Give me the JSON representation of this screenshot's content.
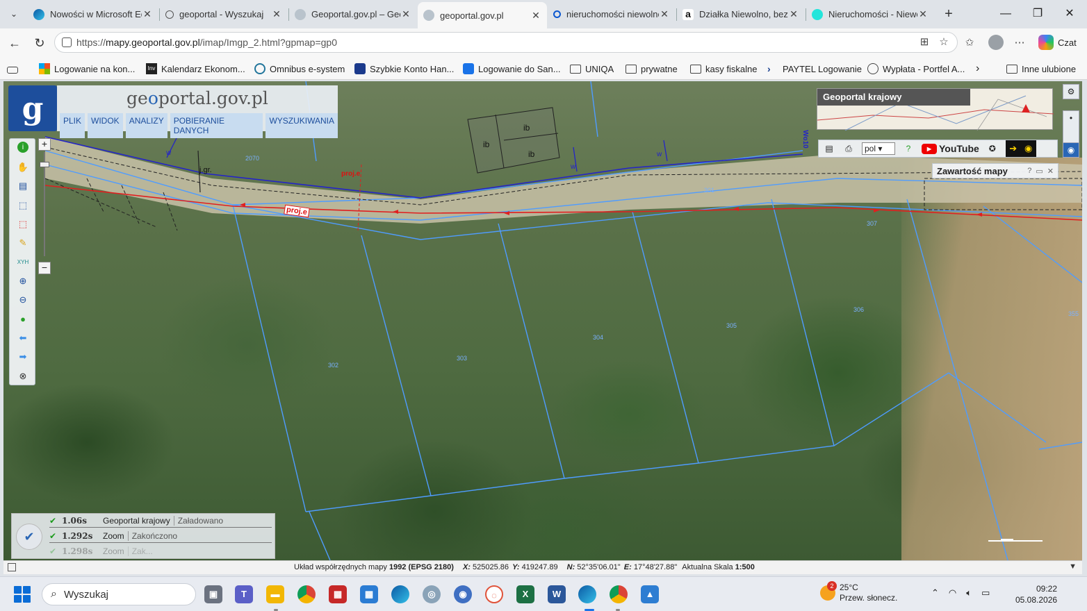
{
  "tabs": [
    {
      "title": "Nowości w Microsoft Edge",
      "icon": "edge-icon"
    },
    {
      "title": "geoportal - Wyszukaj",
      "icon": "search-icon"
    },
    {
      "title": "Geoportal.gov.pl – Geoportal",
      "icon": "geoportal-icon"
    },
    {
      "title": "geoportal.gov.pl",
      "icon": "geoportal-icon",
      "active": true
    },
    {
      "title": "nieruchomości niewolno",
      "icon": "search-icon"
    },
    {
      "title": "Działka Niewolno, bez p",
      "icon": "amazon-icon"
    },
    {
      "title": "Nieruchomości - Niewolno",
      "icon": "olx-icon"
    }
  ],
  "address": {
    "prefix": "https://",
    "host": "mapy.geoportal.gov.pl",
    "path": "/imap/Imgp_2.html?gpmap=gp0"
  },
  "copilot_label": "Czat",
  "favorites": [
    {
      "label": "Logowanie na kon...",
      "icon": "microsoft-icon"
    },
    {
      "label": "Kalendarz Ekonom...",
      "icon": "inv-icon"
    },
    {
      "label": "Omnibus e-system",
      "icon": "wordpress-icon"
    },
    {
      "label": "Szybkie Konto Han...",
      "icon": "pko-icon"
    },
    {
      "label": "Logowanie do San...",
      "icon": "doc-icon"
    },
    {
      "label": "UNIQA",
      "icon": "folder-icon"
    },
    {
      "label": "prywatne",
      "icon": "folder-icon"
    },
    {
      "label": "kasy fiskalne",
      "icon": "folder-icon"
    },
    {
      "label": "PAYTEL Logowanie",
      "icon": "arrow-icon"
    },
    {
      "label": "Wypłata - Portfel A...",
      "icon": "globe-icon"
    }
  ],
  "favorites_other": "Inne ulubione",
  "geoportal": {
    "site_name_prefix": "ge",
    "site_name_o": "o",
    "site_name_rest": "portal.gov.pl",
    "menu": [
      "PLIK",
      "WIDOK",
      "ANALIZY",
      "POBIERANIE DANYCH",
      "WYSZUKIWANIA"
    ],
    "overview_title": "Geoportal krajowy",
    "language": "pol",
    "youtube_label": "YouTube",
    "content_panel_title": "Zawartość mapy"
  },
  "map_labels": {
    "ib": [
      "ib",
      "ib",
      "ib"
    ],
    "parcels": [
      "2070",
      "301",
      "307",
      "302",
      "303",
      "304",
      "305",
      "306",
      "355"
    ],
    "jgr": "j.gr.",
    "proj_e": "proj.e",
    "wo10": "Wo10",
    "w": "w"
  },
  "load_log": [
    {
      "time": "1.06s",
      "source": "Geoportal krajowy",
      "status": "Załadowano"
    },
    {
      "time": "1.292s",
      "source": "Zoom",
      "status": "Zakończono"
    },
    {
      "time": "1.298s",
      "source": "Zoom",
      "status": "Zak..."
    }
  ],
  "status": {
    "crs_label": "Układ współrzędnych mapy",
    "crs_value": "1992 (EPSG 2180)",
    "x_label": "X:",
    "x_value": "525025.86",
    "y_label": "Y:",
    "y_value": "419247.89",
    "n_label": "N:",
    "n_value": "52°35'06.01\"",
    "e_label": "E:",
    "e_value": "17°48'27.88\"",
    "scale_label": "Aktualna Skala",
    "scale_value": "1:500"
  },
  "taskbar": {
    "search_placeholder": "Wyszukaj",
    "weather_temp": "25°C",
    "weather_desc": "Przew. słonecz.",
    "weather_badge": "2",
    "time": "09:22",
    "date": "05.08.2026"
  }
}
